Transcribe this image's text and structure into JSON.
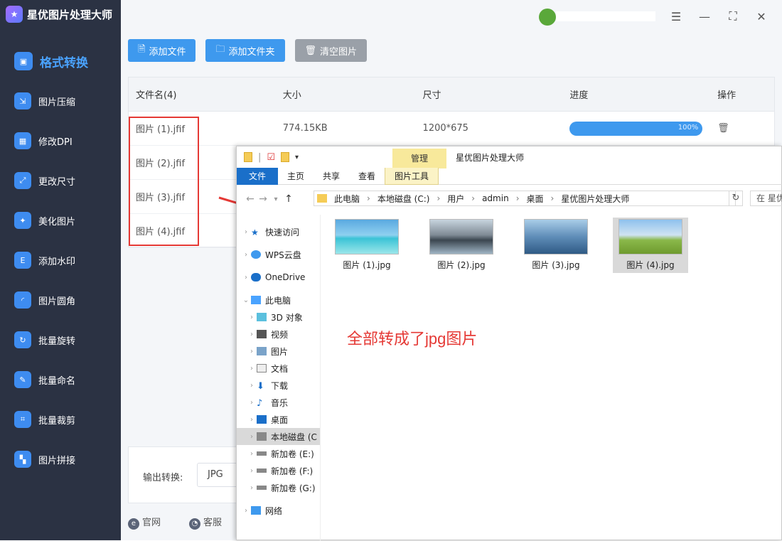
{
  "app": {
    "title": "星优图片处理大师"
  },
  "sidebar": {
    "items": [
      {
        "label": "格式转换",
        "icon": "format-icon"
      },
      {
        "label": "图片压缩",
        "icon": "compress-icon"
      },
      {
        "label": "修改DPI",
        "icon": "dpi-icon"
      },
      {
        "label": "更改尺寸",
        "icon": "resize-icon"
      },
      {
        "label": "美化图片",
        "icon": "beautify-icon"
      },
      {
        "label": "添加水印",
        "icon": "watermark-icon"
      },
      {
        "label": "图片圆角",
        "icon": "rounded-icon"
      },
      {
        "label": "批量旋转",
        "icon": "rotate-icon"
      },
      {
        "label": "批量命名",
        "icon": "rename-icon"
      },
      {
        "label": "批量裁剪",
        "icon": "crop-icon"
      },
      {
        "label": "图片拼接",
        "icon": "stitch-icon"
      }
    ]
  },
  "toolbar": {
    "add_file": "添加文件",
    "add_folder": "添加文件夹",
    "clear": "清空图片"
  },
  "table": {
    "headers": {
      "name": "文件名(4)",
      "size": "大小",
      "dim": "尺寸",
      "progress": "进度",
      "action": "操作"
    },
    "rows": [
      {
        "name": "图片 (1).jfif",
        "size": "774.15KB",
        "dim": "1200*675",
        "progress_text": "100%",
        "progress": 1.0
      },
      {
        "name": "图片 (2).jfif"
      },
      {
        "name": "图片 (3).jfif"
      },
      {
        "name": "图片 (4).jfif"
      }
    ]
  },
  "bottom": {
    "output_label": "输出转换:",
    "output_value": "JPG"
  },
  "footer": {
    "site": "官网",
    "service": "客服"
  },
  "explorer": {
    "title": "星优图片处理大师",
    "manage_tab": "管理",
    "ribbon": {
      "file": "文件",
      "home": "主页",
      "share": "共享",
      "view": "查看",
      "tools": "图片工具"
    },
    "path": [
      "此电脑",
      "本地磁盘 (C:)",
      "用户",
      "admin",
      "桌面",
      "星优图片处理大师"
    ],
    "search": "在 星优",
    "tree": [
      {
        "label": "快速访问",
        "icon": "star-icon"
      },
      {
        "label": "WPS云盘",
        "icon": "cloud-icon"
      },
      {
        "label": "OneDrive",
        "icon": "onedrive-icon"
      },
      {
        "label": "此电脑",
        "icon": "computer-icon"
      },
      {
        "label": "3D 对象",
        "icon": "cube-icon"
      },
      {
        "label": "视频",
        "icon": "video-icon"
      },
      {
        "label": "图片",
        "icon": "picture-icon"
      },
      {
        "label": "文档",
        "icon": "document-icon"
      },
      {
        "label": "下载",
        "icon": "download-icon"
      },
      {
        "label": "音乐",
        "icon": "music-icon"
      },
      {
        "label": "桌面",
        "icon": "desktop-icon"
      },
      {
        "label": "本地磁盘 (C",
        "icon": "drive-icon"
      },
      {
        "label": "新加卷 (E:)",
        "icon": "drive-icon"
      },
      {
        "label": "新加卷 (F:)",
        "icon": "drive-icon"
      },
      {
        "label": "新加卷 (G:)",
        "icon": "drive-icon"
      },
      {
        "label": "网络",
        "icon": "network-icon"
      }
    ],
    "files": [
      "图片 (1).jpg",
      "图片 (2).jpg",
      "图片 (3).jpg",
      "图片 (4).jpg"
    ]
  },
  "annotation": "全部转成了jpg图片"
}
